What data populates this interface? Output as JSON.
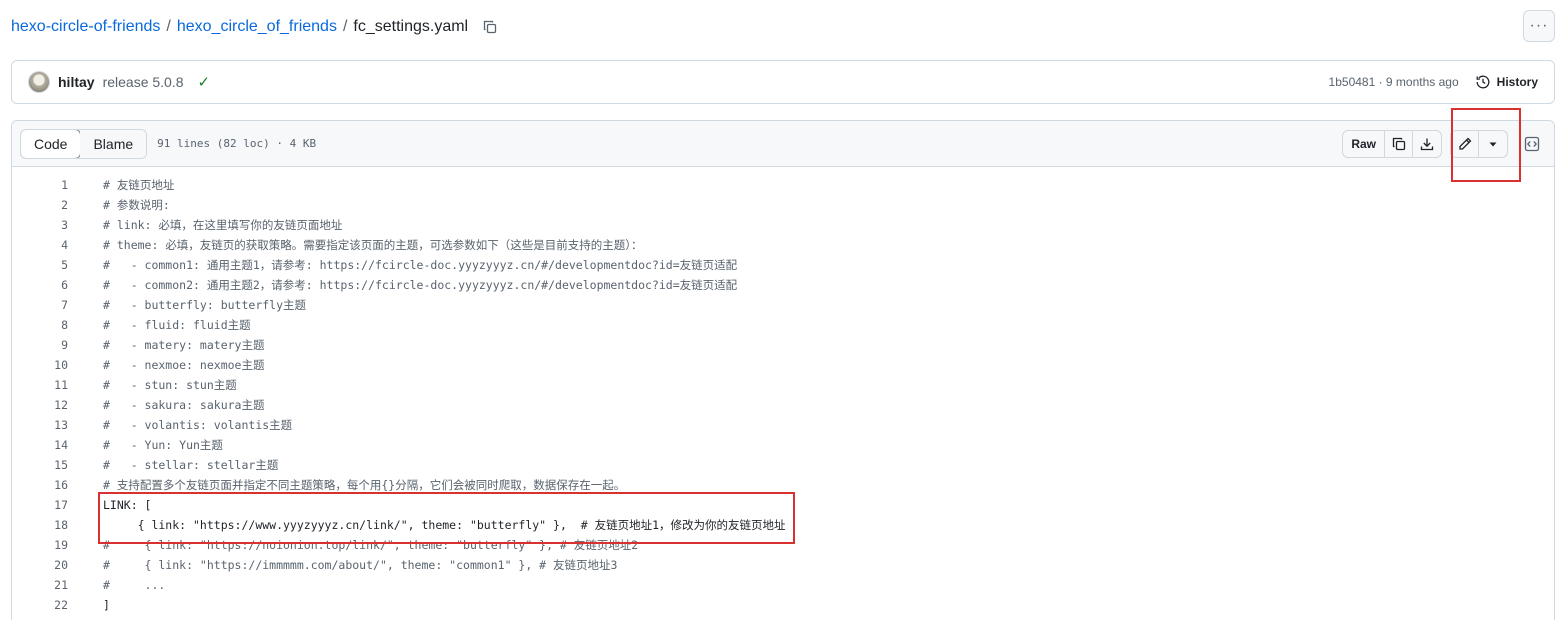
{
  "breadcrumb": {
    "owner": "hexo-circle-of-friends",
    "repo": "hexo_circle_of_friends",
    "file": "fc_settings.yaml",
    "separator": "/"
  },
  "more_label": "···",
  "commit": {
    "author": "hiltay",
    "message": "release 5.0.8",
    "status": "✓",
    "hash_time": "1b50481 · 9 months ago",
    "history_label": "History"
  },
  "file": {
    "tabs": [
      "Code",
      "Blame"
    ],
    "info": "91 lines (82 loc) · 4 KB",
    "raw_label": "Raw"
  },
  "code_lines": [
    {
      "n": "1",
      "t": "# 友链页地址"
    },
    {
      "n": "2",
      "t": "# 参数说明:"
    },
    {
      "n": "3",
      "t": "# link: 必填，在这里填写你的友链页面地址"
    },
    {
      "n": "4",
      "t": "# theme: 必填，友链页的获取策略。需要指定该页面的主题，可选参数如下（这些是目前支持的主题）："
    },
    {
      "n": "5",
      "t": "#   - common1: 通用主题1，请参考: https://fcircle-doc.yyyzyyyz.cn/#/developmentdoc?id=友链页适配"
    },
    {
      "n": "6",
      "t": "#   - common2: 通用主题2，请参考: https://fcircle-doc.yyyzyyyz.cn/#/developmentdoc?id=友链页适配"
    },
    {
      "n": "7",
      "t": "#   - butterfly: butterfly主题"
    },
    {
      "n": "8",
      "t": "#   - fluid: fluid主题"
    },
    {
      "n": "9",
      "t": "#   - matery: matery主题"
    },
    {
      "n": "10",
      "t": "#   - nexmoe: nexmoe主题"
    },
    {
      "n": "11",
      "t": "#   - stun: stun主题"
    },
    {
      "n": "12",
      "t": "#   - sakura: sakura主题"
    },
    {
      "n": "13",
      "t": "#   - volantis: volantis主题"
    },
    {
      "n": "14",
      "t": "#   - Yun: Yun主题"
    },
    {
      "n": "15",
      "t": "#   - stellar: stellar主题"
    },
    {
      "n": "16",
      "t": "# 支持配置多个友链页面并指定不同主题策略，每个用{}分隔，它们会被同时爬取，数据保存在一起。"
    },
    {
      "n": "17",
      "t": "LINK: ["
    },
    {
      "n": "18",
      "t": "     { link: \"https://www.yyyzyyyz.cn/link/\", theme: \"butterfly\" },  # 友链页地址1，修改为你的友链页地址"
    },
    {
      "n": "19",
      "t": "#     { link: \"https://noionion.top/link/\", theme: \"butterfly\" }, # 友链页地址2"
    },
    {
      "n": "20",
      "t": "#     { link: \"https://immmmm.com/about/\", theme: \"common1\" }, # 友链页地址3"
    },
    {
      "n": "21",
      "t": "#     ..."
    },
    {
      "n": "22",
      "t": "]"
    }
  ],
  "colors": {
    "link": "#0969da",
    "annotation": "#d93030",
    "success": "#1a7f37"
  }
}
